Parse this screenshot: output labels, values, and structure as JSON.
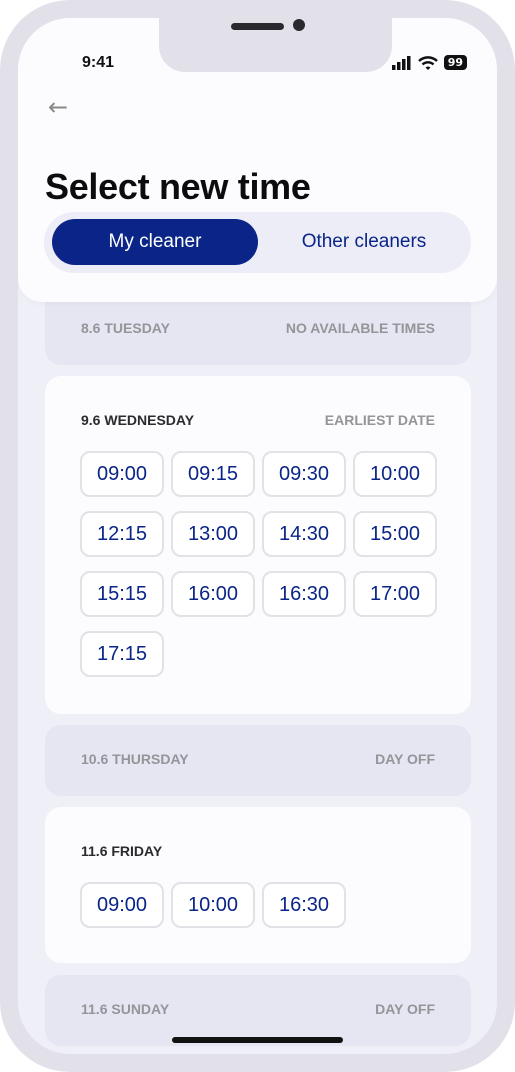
{
  "status_bar": {
    "time": "9:41",
    "battery": "99"
  },
  "header": {
    "title": "Select new time",
    "back_icon": "arrow-left-icon"
  },
  "tabs": [
    {
      "label": "My cleaner",
      "active": true
    },
    {
      "label": "Other cleaners",
      "active": false
    }
  ],
  "colors": {
    "accent": "#0a2587",
    "background": "#efeff8"
  },
  "days": [
    {
      "date": "8.6 TUESDAY",
      "note": "NO AVAILABLE TIMES",
      "slots": []
    },
    {
      "date": "9.6 WEDNESDAY",
      "note": "EARLIEST DATE",
      "slots": [
        "09:00",
        "09:15",
        "09:30",
        "10:00",
        "12:15",
        "13:00",
        "14:30",
        "15:00",
        "15:15",
        "16:00",
        "16:30",
        "17:00",
        "17:15"
      ]
    },
    {
      "date": "10.6 THURSDAY",
      "note": "DAY OFF",
      "slots": []
    },
    {
      "date": "11.6 FRIDAY",
      "note": "",
      "slots": [
        "09:00",
        "10:00",
        "16:30"
      ]
    },
    {
      "date": "11.6 SUNDAY",
      "note": "DAY OFF",
      "slots": []
    }
  ]
}
